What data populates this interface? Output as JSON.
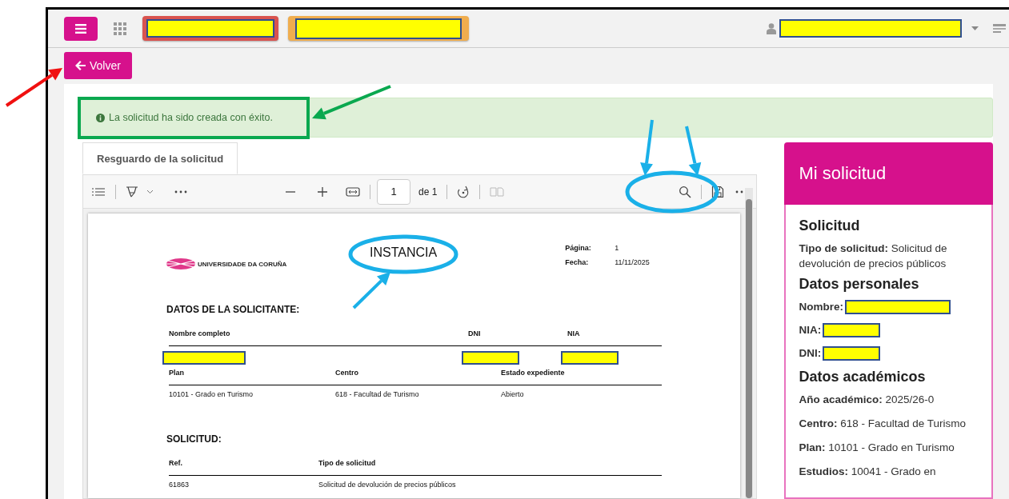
{
  "back_button": {
    "label": "Volver"
  },
  "alert": {
    "text": "La solicitud ha sido creada con éxito."
  },
  "tabs": [
    {
      "label": "Resguardo de la solicitud",
      "selected": true
    }
  ],
  "pdf_toolbar": {
    "page_value": "1",
    "page_total": "de 1"
  },
  "document": {
    "title": "INSTANCIA",
    "logo_text": "UNIVERSIDADE DA CORUÑA",
    "meta": [
      {
        "label": "Página:",
        "value": "1"
      },
      {
        "label": "Fecha:",
        "value": "11/11/2025"
      }
    ],
    "sections": [
      {
        "heading": "DATOS DE LA SOLICITANTE:",
        "tables": [
          {
            "columns": [
              "Nombre completo",
              "DNI",
              "NIA"
            ],
            "rows": [
              [
                {
                  "kind": "redacted"
                },
                {
                  "kind": "redacted"
                },
                {
                  "kind": "redacted"
                }
              ]
            ]
          },
          {
            "columns": [
              "Plan",
              "Centro",
              "Estado expediente"
            ],
            "rows": [
              [
                {
                  "kind": "text",
                  "text": "10101 - Grado en Turismo"
                },
                {
                  "kind": "text",
                  "text": "618 - Facultad de Turismo"
                },
                {
                  "kind": "text",
                  "text": "Abierto"
                }
              ]
            ]
          }
        ]
      },
      {
        "heading": "SOLICITUD:",
        "tables": [
          {
            "columns": [
              "Ref.",
              "Tipo de solicitud"
            ],
            "rows": [
              [
                {
                  "kind": "text",
                  "text": "61863"
                },
                {
                  "kind": "text",
                  "text": "Solicitud de devolución de precios públicos"
                }
              ]
            ]
          }
        ]
      }
    ]
  },
  "panel": {
    "title": "Mi solicitud",
    "sections": [
      {
        "heading": "Solicitud",
        "items": [
          {
            "kind": "text",
            "label": "Tipo de solicitud:",
            "value": "Solicitud de devolución de precios públicos"
          }
        ]
      },
      {
        "heading": "Datos personales",
        "items": [
          {
            "kind": "redacted",
            "label": "Nombre:"
          },
          {
            "kind": "redacted",
            "label": "NIA:"
          },
          {
            "kind": "redacted",
            "label": "DNI:"
          }
        ]
      },
      {
        "heading": "Datos académicos",
        "items": [
          {
            "kind": "text",
            "label": "Año académico:",
            "value": "2025/26-0"
          },
          {
            "kind": "text",
            "label": "Centro:",
            "value": "618 - Facultad de Turismo"
          },
          {
            "kind": "text",
            "label": "Plan:",
            "value": "10101 - Grado en Turismo"
          },
          {
            "kind": "text",
            "label": "Estudios:",
            "value": "10041 - Grado en"
          }
        ]
      }
    ]
  }
}
